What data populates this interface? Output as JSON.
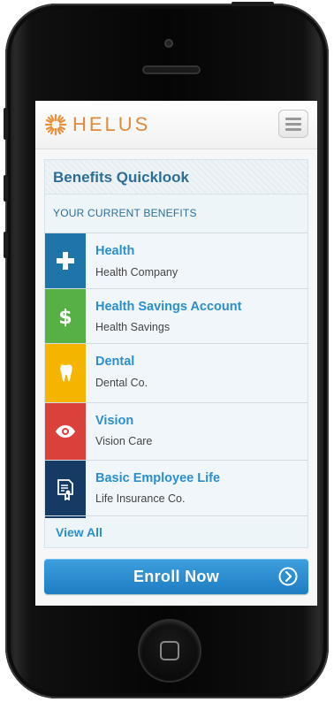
{
  "app": {
    "logo_text": "HELUS",
    "brand_color": "#e08a3c"
  },
  "quicklook": {
    "title": "Benefits Quicklook",
    "section_label": "YOUR CURRENT BENEFITS",
    "benefits": [
      {
        "name": "Health",
        "provider": "Health Company",
        "icon": "plus-icon",
        "color": "#1f75a8"
      },
      {
        "name": "Health Savings Account",
        "provider": "Health Savings",
        "icon": "dollar-icon",
        "color": "#56b046"
      },
      {
        "name": "Dental",
        "provider": "Dental Co.",
        "icon": "tooth-icon",
        "color": "#f4b400"
      },
      {
        "name": "Vision",
        "provider": "Vision Care",
        "icon": "eye-icon",
        "color": "#d9413a"
      },
      {
        "name": "Basic Employee Life",
        "provider": "Life Insurance Co.",
        "icon": "certificate-icon",
        "color": "#153a63"
      }
    ],
    "view_all": "View All"
  },
  "actions": {
    "enroll_label": "Enroll Now"
  }
}
